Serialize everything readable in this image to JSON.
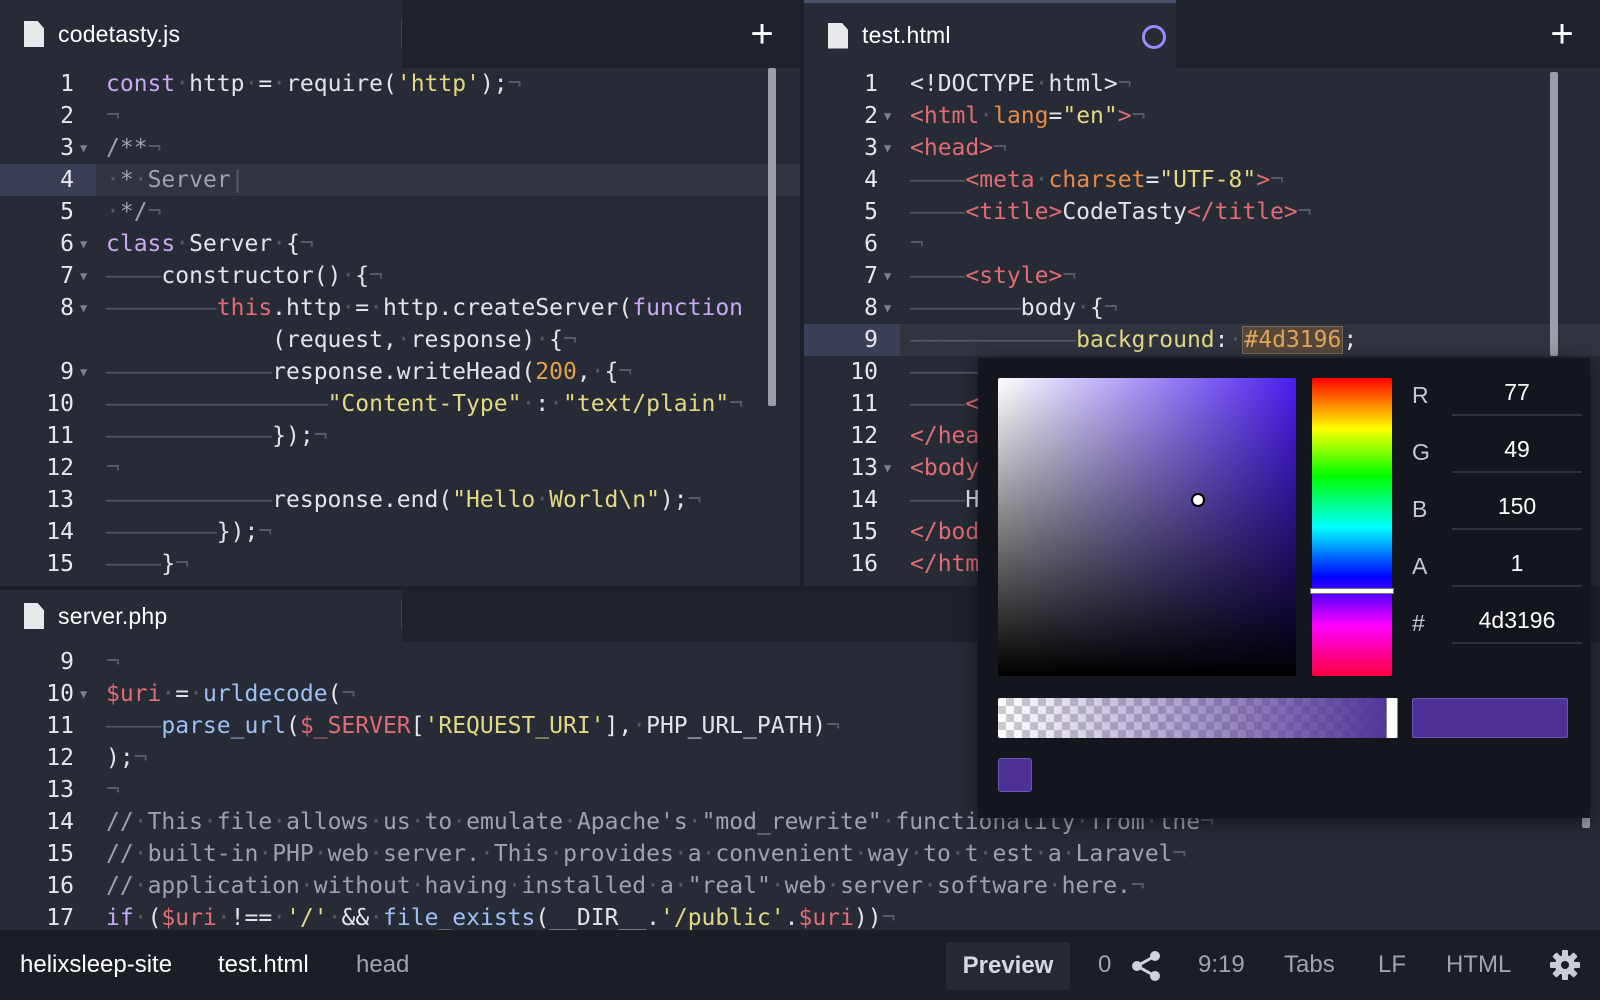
{
  "panes": {
    "js": {
      "tab": {
        "label": "codetasty.js",
        "add_label": "+"
      },
      "lines": [
        {
          "n": "1",
          "html": "<span class='kw'>const</span><span class='ws'>·</span><span class='pl'>http</span><span class='ws'>·</span><span class='pl'>=</span><span class='ws'>·</span><span class='pl'>require(</span><span class='str'>'http'</span><span class='pl'>);</span><span class='ws'>¬</span>"
        },
        {
          "n": "2",
          "html": "<span class='ws'>¬</span>"
        },
        {
          "n": "3",
          "fold": true,
          "html": "<span class='cm'>/**</span><span class='ws'>¬</span>"
        },
        {
          "n": "4",
          "hl": true,
          "html": "<span class='ws'>·</span><span class='cm'>*</span><span class='ws'>·</span><span class='cm'>Server</span><span class='ws'>|</span>"
        },
        {
          "n": "5",
          "html": "<span class='ws'>·</span><span class='cm'>*/</span><span class='ws'>¬</span>"
        },
        {
          "n": "6",
          "fold": true,
          "html": "<span class='kw'>class</span><span class='ws'>·</span><span class='pl'>Server</span><span class='ws'>·</span><span class='pl'>{</span><span class='ws'>¬</span>"
        },
        {
          "n": "7",
          "fold": true,
          "html": "<span class='ws'>————</span><span class='pl'>constructor()</span><span class='ws'>·</span><span class='pl'>{</span><span class='ws'>¬</span>"
        },
        {
          "n": "8",
          "fold": true,
          "html": "<span class='ws'>————————</span><span class='kw2'>this</span><span class='pl'>.http</span><span class='ws'>·</span><span class='pl'>=</span><span class='ws'>·</span><span class='pl'>http.createServer(</span><span class='kw'>function</span>"
        },
        {
          "n": "",
          "html": "<span class='ws'>            </span><span class='pl'>(request,</span><span class='ws'>·</span><span class='pl'>response)</span><span class='ws'>·</span><span class='pl'>{</span><span class='ws'>¬</span>"
        },
        {
          "n": "9",
          "fold": true,
          "html": "<span class='ws'>————————————</span><span class='pl'>response.writeHead(</span><span class='num'>200</span><span class='pl'>,</span><span class='ws'>·</span><span class='pl'>{</span><span class='ws'>¬</span>"
        },
        {
          "n": "10",
          "html": "<span class='ws'>————————————————</span><span class='str'>\"Content-Type\"</span><span class='ws'>·</span><span class='pl'>:</span><span class='ws'>·</span><span class='str'>\"text/plain\"</span><span class='ws'>¬</span>"
        },
        {
          "n": "11",
          "html": "<span class='ws'>————————————</span><span class='pl'>});</span><span class='ws'>¬</span>"
        },
        {
          "n": "12",
          "html": "<span class='ws'>¬</span>"
        },
        {
          "n": "13",
          "html": "<span class='ws'>————————————</span><span class='pl'>response.end(</span><span class='str'>\"Hello</span><span class='ws'>·</span><span class='str'>World\\n\"</span><span class='pl'>);</span><span class='ws'>¬</span>"
        },
        {
          "n": "14",
          "html": "<span class='ws'>————————</span><span class='pl'>});</span><span class='ws'>¬</span>"
        },
        {
          "n": "15",
          "html": "<span class='ws'>————</span><span class='pl'>}</span><span class='ws'>¬</span>"
        }
      ]
    },
    "html": {
      "tab": {
        "label": "test.html",
        "add_label": "+"
      },
      "lines": [
        {
          "n": "1",
          "html": "<span class='pl'>&lt;!DOCTYPE</span><span class='ws'>·</span><span class='pl'>html&gt;</span><span class='ws'>¬</span>"
        },
        {
          "n": "2",
          "fold": true,
          "html": "<span class='tag'>&lt;html</span><span class='ws'>·</span><span class='attr'>lang</span><span class='pl'>=</span><span class='str'>\"en\"</span><span class='tag'>&gt;</span><span class='ws'>¬</span>"
        },
        {
          "n": "3",
          "fold": true,
          "html": "<span class='tag'>&lt;head&gt;</span><span class='ws'>¬</span>"
        },
        {
          "n": "4",
          "html": "<span class='ws'>————</span><span class='tag'>&lt;meta</span><span class='ws'>·</span><span class='attr'>charset</span><span class='pl'>=</span><span class='str'>\"UTF-8\"</span><span class='tag'>&gt;</span><span class='ws'>¬</span>"
        },
        {
          "n": "5",
          "html": "<span class='ws'>————</span><span class='tag'>&lt;title&gt;</span><span class='pl'>CodeTasty</span><span class='tag'>&lt;/title&gt;</span><span class='ws'>¬</span>"
        },
        {
          "n": "6",
          "html": "<span class='ws'>¬</span>"
        },
        {
          "n": "7",
          "fold": true,
          "html": "<span class='ws'>————</span><span class='tag'>&lt;style&gt;</span><span class='ws'>¬</span>"
        },
        {
          "n": "8",
          "fold": true,
          "html": "<span class='ws'>————————</span><span class='pl'>body</span><span class='ws'>·</span><span class='pl'>{</span><span class='ws'>¬</span>"
        },
        {
          "n": "9",
          "hl": true,
          "html": "<span class='ws'>————————————</span><span class='str'>background</span><span class='pl'>:</span><span class='ws'>·</span><span class='hex'>#4d3196</span><span class='pl'>;</span>"
        },
        {
          "n": "10",
          "html": "<span class='ws'>————————</span><span class='pl'>}</span>"
        },
        {
          "n": "11",
          "html": "<span class='ws'>————</span><span class='tag'>&lt;</span>"
        },
        {
          "n": "12",
          "html": "<span class='tag'>&lt;/hea</span>"
        },
        {
          "n": "13",
          "fold": true,
          "html": "<span class='tag'>&lt;body</span>"
        },
        {
          "n": "14",
          "html": "<span class='ws'>————</span><span class='pl'>H</span>"
        },
        {
          "n": "15",
          "html": "<span class='tag'>&lt;/bod</span>"
        },
        {
          "n": "16",
          "html": "<span class='tag'>&lt;/htm</span>"
        }
      ]
    },
    "php": {
      "tab": {
        "label": "server.php"
      },
      "lines": [
        {
          "n": "9",
          "html": "<span class='ws'>¬</span>"
        },
        {
          "n": "10",
          "fold": true,
          "html": "<span class='var'>$uri</span><span class='ws'>·</span><span class='pl'>=</span><span class='ws'>·</span><span class='fn'>urldecode</span><span class='pl'>(</span><span class='ws'>¬</span>"
        },
        {
          "n": "11",
          "html": "<span class='ws'>————</span><span class='fn'>parse_url</span><span class='pl'>(</span><span class='var'>$_SERVER</span><span class='pl'>[</span><span class='str'>'REQUEST_URI'</span><span class='pl'>],</span><span class='ws'>·</span><span class='pl'>PHP_URL_PATH)</span><span class='ws'>¬</span>"
        },
        {
          "n": "12",
          "html": "<span class='pl'>);</span><span class='ws'>¬</span>"
        },
        {
          "n": "13",
          "html": "<span class='ws'>¬</span>"
        },
        {
          "n": "14",
          "html": "<span class='cm'>//</span><span class='ws'>·</span><span class='cm'>This</span><span class='ws'>·</span><span class='cm'>file</span><span class='ws'>·</span><span class='cm'>allows</span><span class='ws'>·</span><span class='cm'>us</span><span class='ws'>·</span><span class='cm'>to</span><span class='ws'>·</span><span class='cm'>emulate</span><span class='ws'>·</span><span class='cm'>Apache's</span><span class='ws'>·</span><span class='cm'>\"mod_rewrite\"</span><span class='ws'>·</span><span class='cm'>functionality</span><span class='ws'>·</span><span class='cm'>from</span><span class='ws'>·</span><span class='cm'>the</span><span class='ws'>¬</span>"
        },
        {
          "n": "15",
          "html": "<span class='cm'>//</span><span class='ws'>·</span><span class='cm'>built-in</span><span class='ws'>·</span><span class='cm'>PHP</span><span class='ws'>·</span><span class='cm'>web</span><span class='ws'>·</span><span class='cm'>server.</span><span class='ws'>·</span><span class='cm'>This</span><span class='ws'>·</span><span class='cm'>provides</span><span class='ws'>·</span><span class='cm'>a</span><span class='ws'>·</span><span class='cm'>convenient</span><span class='ws'>·</span><span class='cm'>way</span><span class='ws'>·</span><span class='cm'>to</span><span class='ws'>·</span><span class='cm'>t</span><span class='ws'>·</span><span class='cm'>est</span><span class='ws'>·</span><span class='cm'>a</span><span class='ws'>·</span><span class='cm'>Laravel</span><span class='ws'>¬</span>"
        },
        {
          "n": "16",
          "html": "<span class='cm'>//</span><span class='ws'>·</span><span class='cm'>application</span><span class='ws'>·</span><span class='cm'>without</span><span class='ws'>·</span><span class='cm'>having</span><span class='ws'>·</span><span class='cm'>installed</span><span class='ws'>·</span><span class='cm'>a</span><span class='ws'>·</span><span class='cm'>\"real\"</span><span class='ws'>·</span><span class='cm'>web</span><span class='ws'>·</span><span class='cm'>server</span><span class='ws'>·</span><span class='cm'>software</span><span class='ws'>·</span><span class='cm'>here.</span><span class='ws'>¬</span>"
        },
        {
          "n": "17",
          "html": "<span class='kw'>if</span><span class='ws'>·</span><span class='pl'>(</span><span class='var'>$uri</span><span class='ws'>·</span><span class='pl'>!==</span><span class='ws'>·</span><span class='str'>'/'</span><span class='ws'>·</span><span class='pl'>&amp;&amp;</span><span class='ws'>·</span><span class='fn'>file_exists</span><span class='pl'>(__DIR__.</span><span class='str'>'/public'</span><span class='pl'>.</span><span class='var'>$uri</span><span class='pl'>))</span><span class='ws'>¬</span>"
        }
      ]
    }
  },
  "color_picker": {
    "channels": [
      {
        "label": "R",
        "value": "77"
      },
      {
        "label": "G",
        "value": "49"
      },
      {
        "label": "B",
        "value": "150"
      },
      {
        "label": "A",
        "value": "1"
      },
      {
        "label": "#",
        "value": "4d3196"
      }
    ],
    "color": "#4d3196",
    "alpha": 1,
    "saturation": 0.67,
    "brightness": 0.59,
    "hue_degrees": 257
  },
  "status_bar": {
    "project": "helixsleep-site",
    "file": "test.html",
    "scope": "head",
    "preview_label": "Preview",
    "share_count": "0",
    "cursor_position": "9:19",
    "indentation": "Tabs",
    "line_endings": "LF",
    "language": "HTML"
  },
  "icons": {
    "file": "file-icon",
    "add": "plus-icon",
    "modified": "unsaved-circle-icon",
    "share": "share-icon",
    "settings": "gear-icon"
  }
}
